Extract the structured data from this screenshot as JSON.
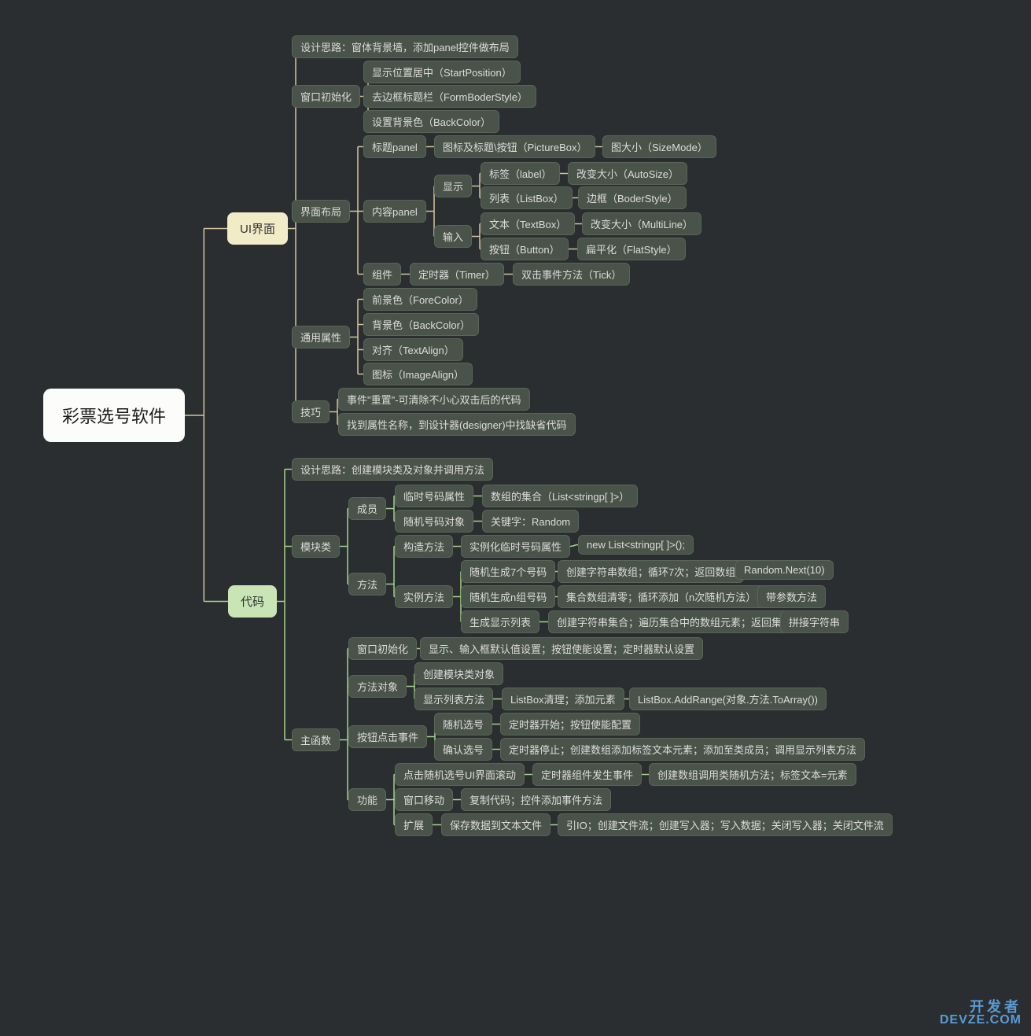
{
  "watermark": {
    "line1": "开发者",
    "line2": "DEVZE.COM"
  },
  "nodes": {
    "root": "彩票选号软件",
    "ui": "UI界面",
    "code": "代码",
    "n1": "设计思路：窗体背景墙，添加panel控件做布局",
    "n2": "窗口初始化",
    "n2a": "显示位置居中（StartPosition）",
    "n2b": "去边框标题栏（FormBoderStyle）",
    "n2c": "设置背景色（BackColor）",
    "n3": "界面布局",
    "n3a": "标题panel",
    "n3a1": "图标及标题\\按钮（PictureBox）",
    "n3a2": "图大小（SizeMode）",
    "n3b": "内容panel",
    "n3b1": "显示",
    "n3b1a": "标签（label）",
    "n3b1a2": "改变大小（AutoSize）",
    "n3b1b": "列表（ListBox）",
    "n3b1b2": "边框（BoderStyle）",
    "n3b2": "输入",
    "n3b2a": "文本（TextBox）",
    "n3b2a2": "改变大小（MultiLine）",
    "n3b2b": "按钮（Button）",
    "n3b2b2": "扁平化（FlatStyle）",
    "n3c": "组件",
    "n3c1": "定时器（Timer）",
    "n3c2": "双击事件方法（Tick）",
    "n4": "通用属性",
    "n4a": "前景色（ForeColor）",
    "n4b": "背景色（BackColor）",
    "n4c": "对齐（TextAlign）",
    "n4d": "图标（ImageAlign）",
    "n5": "技巧",
    "n5a": "事件\"重置\"-可清除不小心双击后的代码",
    "n5b": "找到属性名称，到设计器(designer)中找缺省代码",
    "c1": "设计思路：创建模块类及对象并调用方法",
    "c2": "模块类",
    "c2a": "成员",
    "c2a1": "临时号码属性",
    "c2a1b": "数组的集合（List<stringp[ ]>）",
    "c2a2": "随机号码对象",
    "c2a2b": "关键字：Random",
    "c2b": "方法",
    "c2b1": "构造方法",
    "c2b1a": "实例化临时号码属性",
    "c2b1b": "new List<stringp[ ]>();",
    "c2b2": "实例方法",
    "c2b2a": "随机生成7个号码",
    "c2b2a2": "创建字符串数组；循环7次；返回数组",
    "c2b2a3": "Random.Next(10)",
    "c2b2b": "随机生成n组号码",
    "c2b2b2": "集合数组清零；循环添加（n次随机方法）",
    "c2b2b3": "带参数方法",
    "c2b2c": "生成显示列表",
    "c2b2c2": "创建字符串集合；遍历集合中的数组元素；返回集合",
    "c2b2c3": "拼接字符串",
    "c3": "主函数",
    "c3a": "窗口初始化",
    "c3a1": "显示、输入框默认值设置；按钮使能设置；定时器默认设置",
    "c3b": "方法对象",
    "c3b1": "创建模块类对象",
    "c3b2": "显示列表方法",
    "c3b2a": "ListBox清理；添加元素",
    "c3b2b": "ListBox.AddRange(对象.方法.ToArray())",
    "c3c": "按钮点击事件",
    "c3c1": "随机选号",
    "c3c1a": "定时器开始；按钮使能配置",
    "c3c2": "确认选号",
    "c3c2a": "定时器停止；创建数组添加标签文本元素；添加至类成员；调用显示列表方法",
    "c3d": "功能",
    "c3d1": "点击随机选号UI界面滚动",
    "c3d1a": "定时器组件发生事件",
    "c3d1b": "创建数组调用类随机方法；标签文本=元素",
    "c3d2": "窗口移动",
    "c3d2a": "复制代码；控件添加事件方法",
    "c3d3": "扩展",
    "c3d3a": "保存数据到文本文件",
    "c3d3b": "引IO；创建文件流；创建写入器；写入数据；关闭写入器；关闭文件流"
  }
}
